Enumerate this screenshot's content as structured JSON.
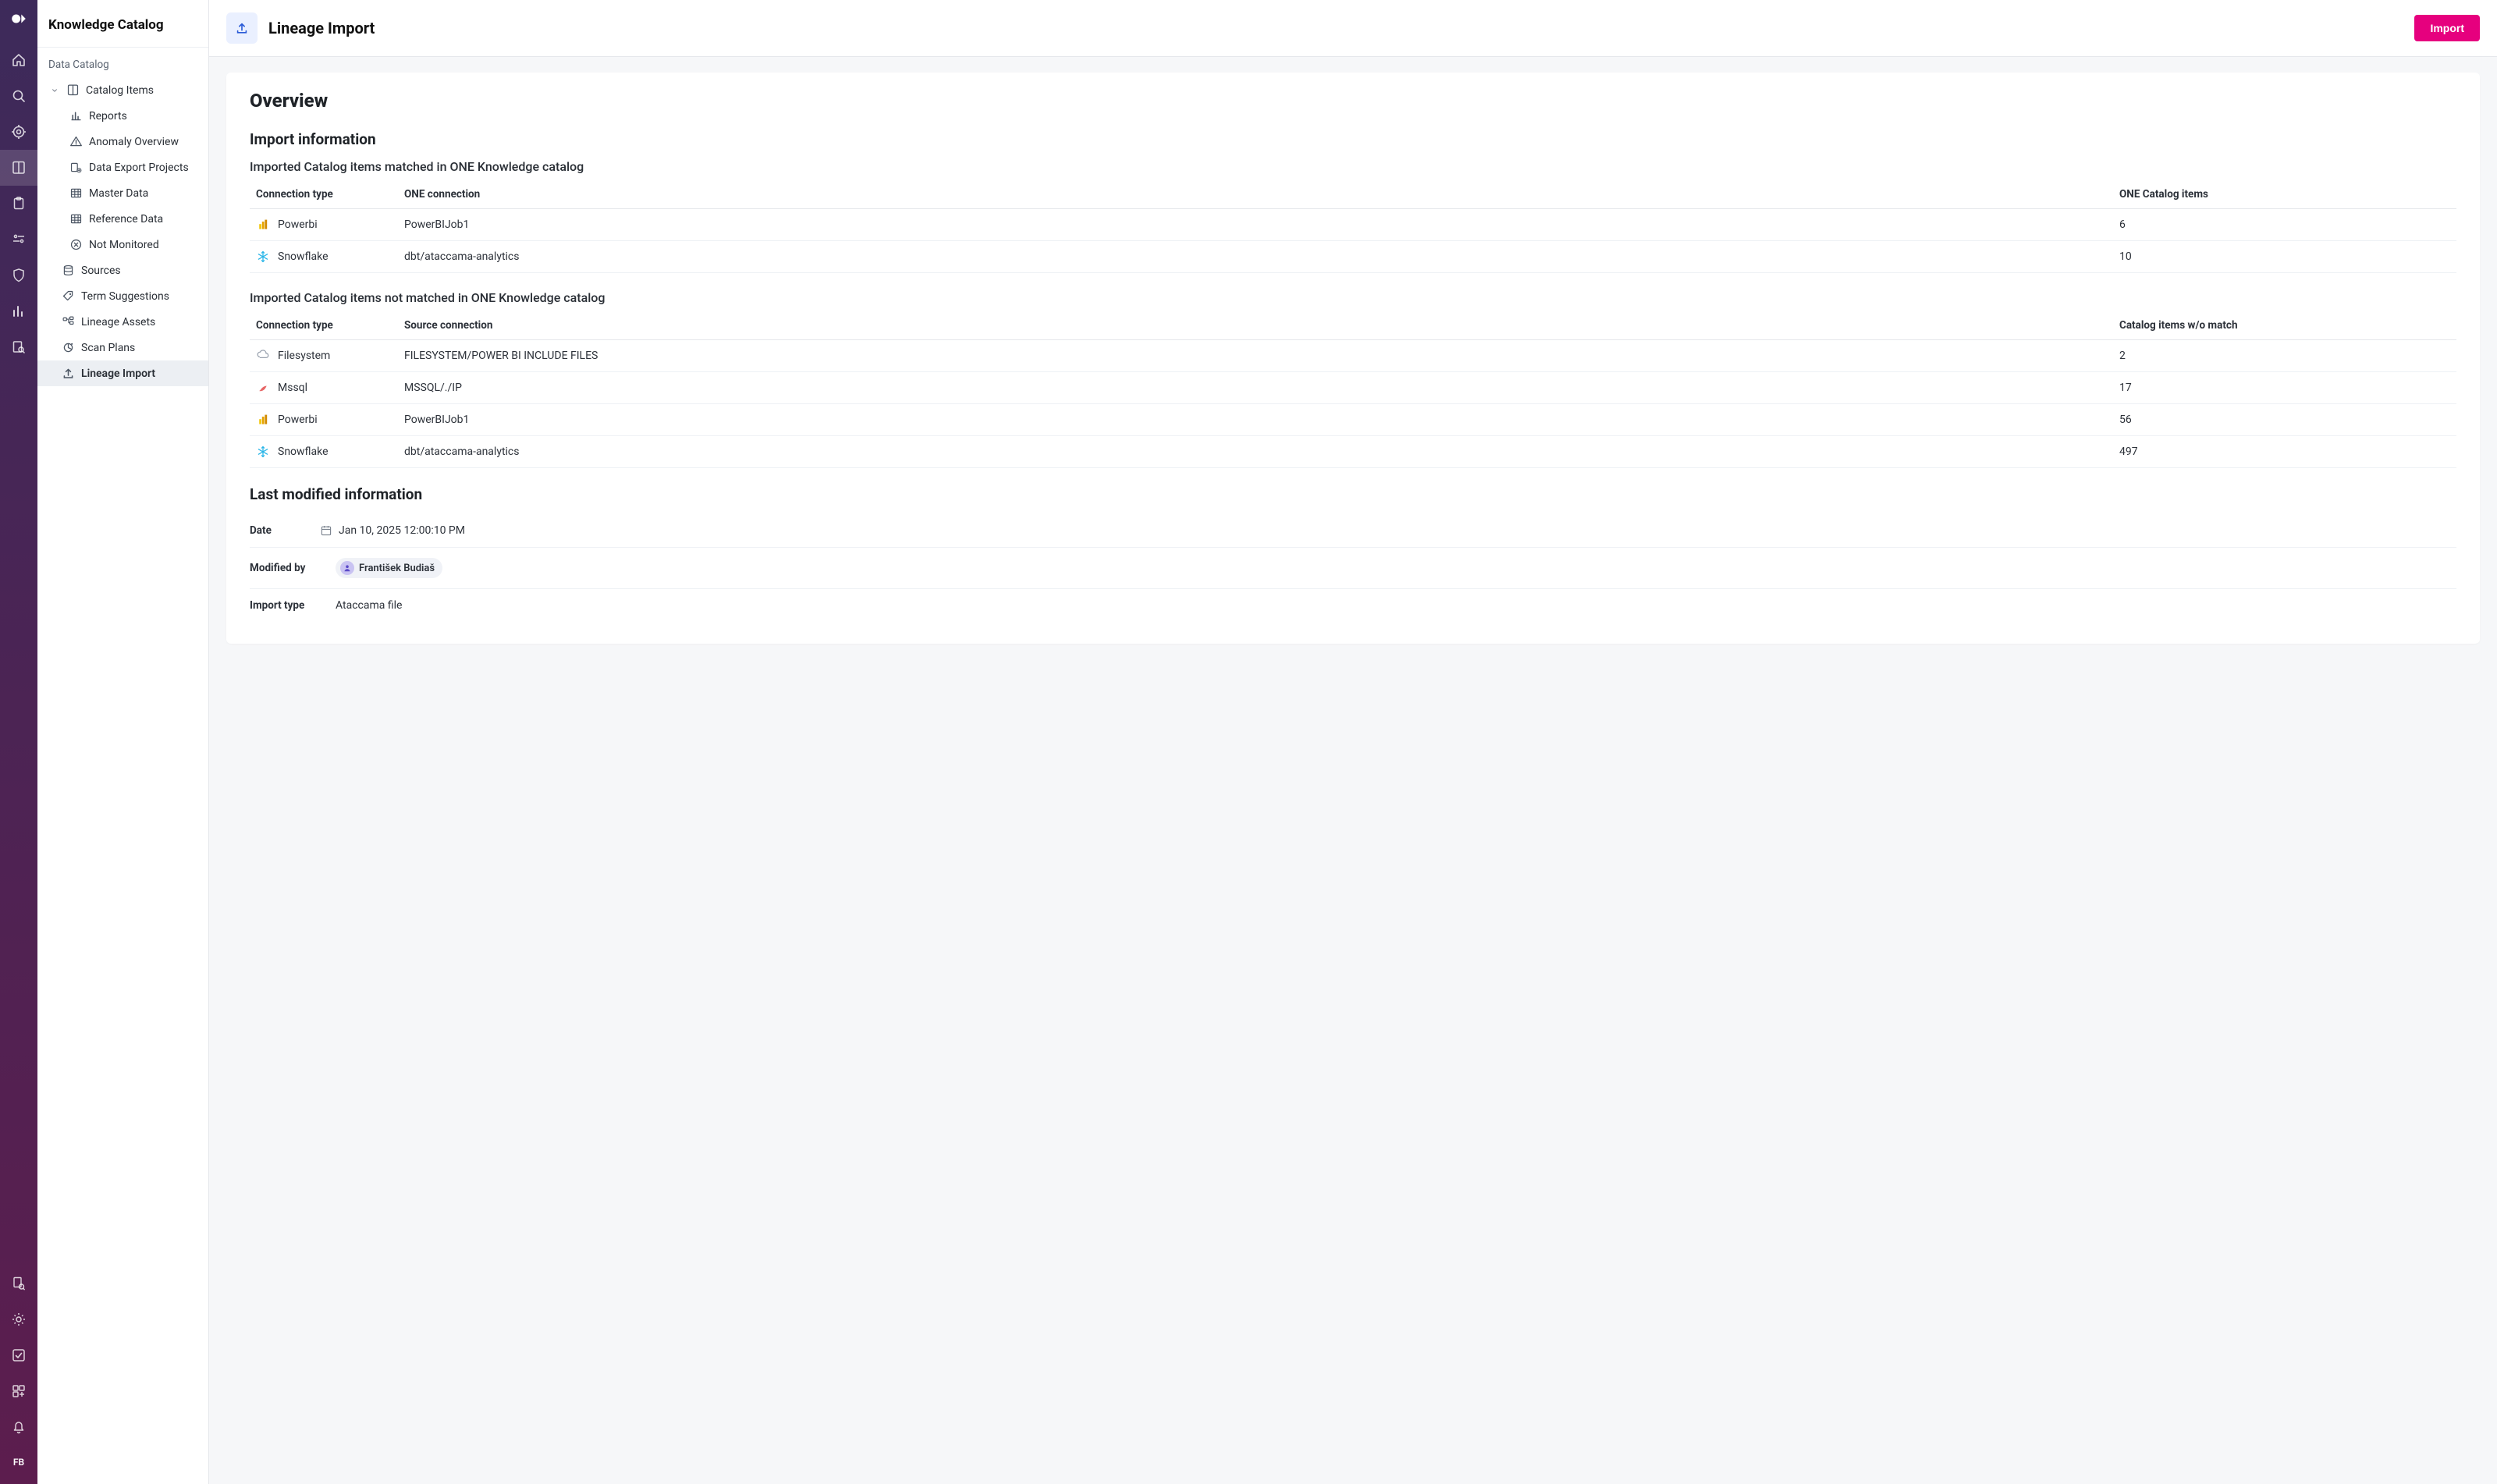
{
  "app": {
    "sidebar_title": "Knowledge Catalog",
    "page_title": "Lineage Import",
    "import_button": "Import",
    "user_initials": "FB"
  },
  "sidebar": {
    "section_label": "Data Catalog",
    "root_label": "Catalog Items",
    "children": [
      "Reports",
      "Anomaly Overview",
      "Data Export Projects",
      "Master Data",
      "Reference Data",
      "Not Monitored"
    ],
    "items": [
      "Sources",
      "Term Suggestions",
      "Lineage Assets",
      "Scan Plans",
      "Lineage Import"
    ]
  },
  "overview": {
    "title": "Overview",
    "import_info_heading": "Import information",
    "matched_subhead": "Imported Catalog items matched in ONE Knowledge catalog",
    "not_matched_subhead": "Imported Catalog items not matched in ONE Knowledge catalog",
    "matched_headers": [
      "Connection type",
      "ONE connection",
      "ONE Catalog items"
    ],
    "not_matched_headers": [
      "Connection type",
      "Source connection",
      "Catalog items w/o match"
    ],
    "matched_rows": [
      {
        "type": "Powerbi",
        "conn": "PowerBIJob1",
        "count": "6",
        "icon": "powerbi"
      },
      {
        "type": "Snowflake",
        "conn": "dbt/ataccama-analytics",
        "count": "10",
        "icon": "snowflake"
      }
    ],
    "not_matched_rows": [
      {
        "type": "Filesystem",
        "conn": "FILESYSTEM/POWER BI INCLUDE FILES",
        "count": "2",
        "icon": "filesystem"
      },
      {
        "type": "Mssql",
        "conn": "MSSQL/./IP",
        "count": "17",
        "icon": "mssql"
      },
      {
        "type": "Powerbi",
        "conn": "PowerBIJob1",
        "count": "56",
        "icon": "powerbi"
      },
      {
        "type": "Snowflake",
        "conn": "dbt/ataccama-analytics",
        "count": "497",
        "icon": "snowflake"
      }
    ],
    "last_modified_heading": "Last modified information",
    "date_label": "Date",
    "date_value": "Jan 10, 2025 12:00:10 PM",
    "modified_by_label": "Modified by",
    "modified_by_value": "František Budiaš",
    "import_type_label": "Import type",
    "import_type_value": "Ataccama file"
  }
}
